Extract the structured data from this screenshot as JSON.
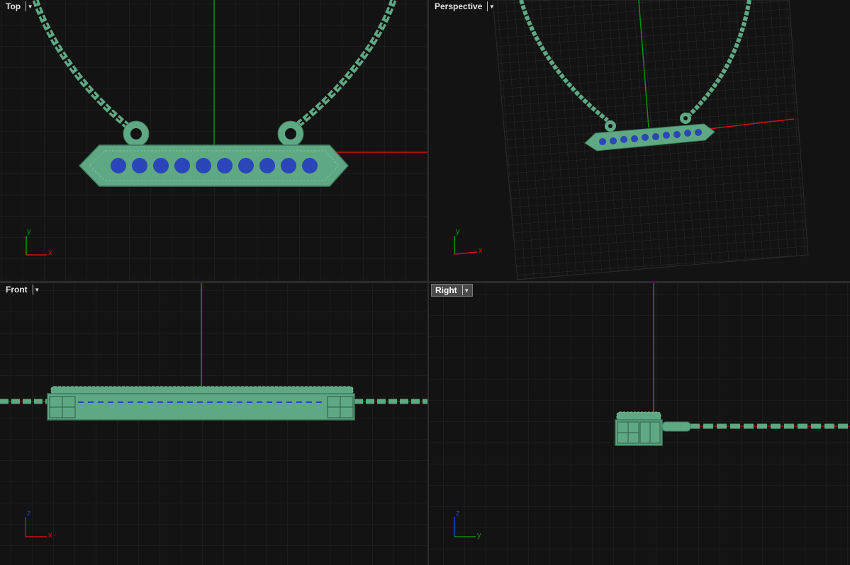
{
  "viewports": {
    "top": {
      "title": "Top",
      "axis_h": "x",
      "axis_v": "y"
    },
    "perspective": {
      "title": "Perspective",
      "axis_h": "x",
      "axis_v": "y"
    },
    "front": {
      "title": "Front",
      "axis_h": "x",
      "axis_v": "z"
    },
    "right": {
      "title": "Right",
      "axis_h": "y",
      "axis_v": "z",
      "active": true
    }
  },
  "colors": {
    "background": "#131313",
    "grid": "#262626",
    "x_axis": "#d01010",
    "y_axis": "#109010",
    "z_axis": "#2040d0",
    "model_green": "#5fa884",
    "stone_blue": "#2b46b8"
  },
  "pendant": {
    "stone_count": 10
  }
}
